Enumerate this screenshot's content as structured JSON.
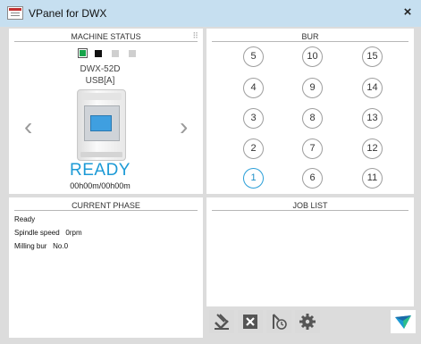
{
  "window": {
    "title": "VPanel for DWX",
    "close_label": "×"
  },
  "machine_status": {
    "header": "MACHINE STATUS",
    "model": "DWX-52D",
    "port": "USB[A]",
    "state": "READY",
    "time": "00h00m/00h00m",
    "prev_arrow": "‹",
    "next_arrow": "›"
  },
  "bur": {
    "header": "BUR",
    "slots": [
      "5",
      "10",
      "15",
      "4",
      "9",
      "14",
      "3",
      "8",
      "13",
      "2",
      "7",
      "12",
      "1",
      "6",
      "11"
    ],
    "selected": "1"
  },
  "current_phase": {
    "header": "CURRENT PHASE",
    "status": "Ready",
    "spindle": "Spindle speed   0rpm",
    "milling_bur": "Milling bur   No.0"
  },
  "job_list": {
    "header": "JOB LIST"
  },
  "toolbar": {
    "buttons": [
      "output-icon",
      "delete-icon",
      "schedule-icon",
      "settings-icon",
      "logo-icon"
    ]
  },
  "colors": {
    "accent": "#1c9ad6",
    "titlebar": "#c6dff0",
    "status_green": "#16a34a"
  }
}
